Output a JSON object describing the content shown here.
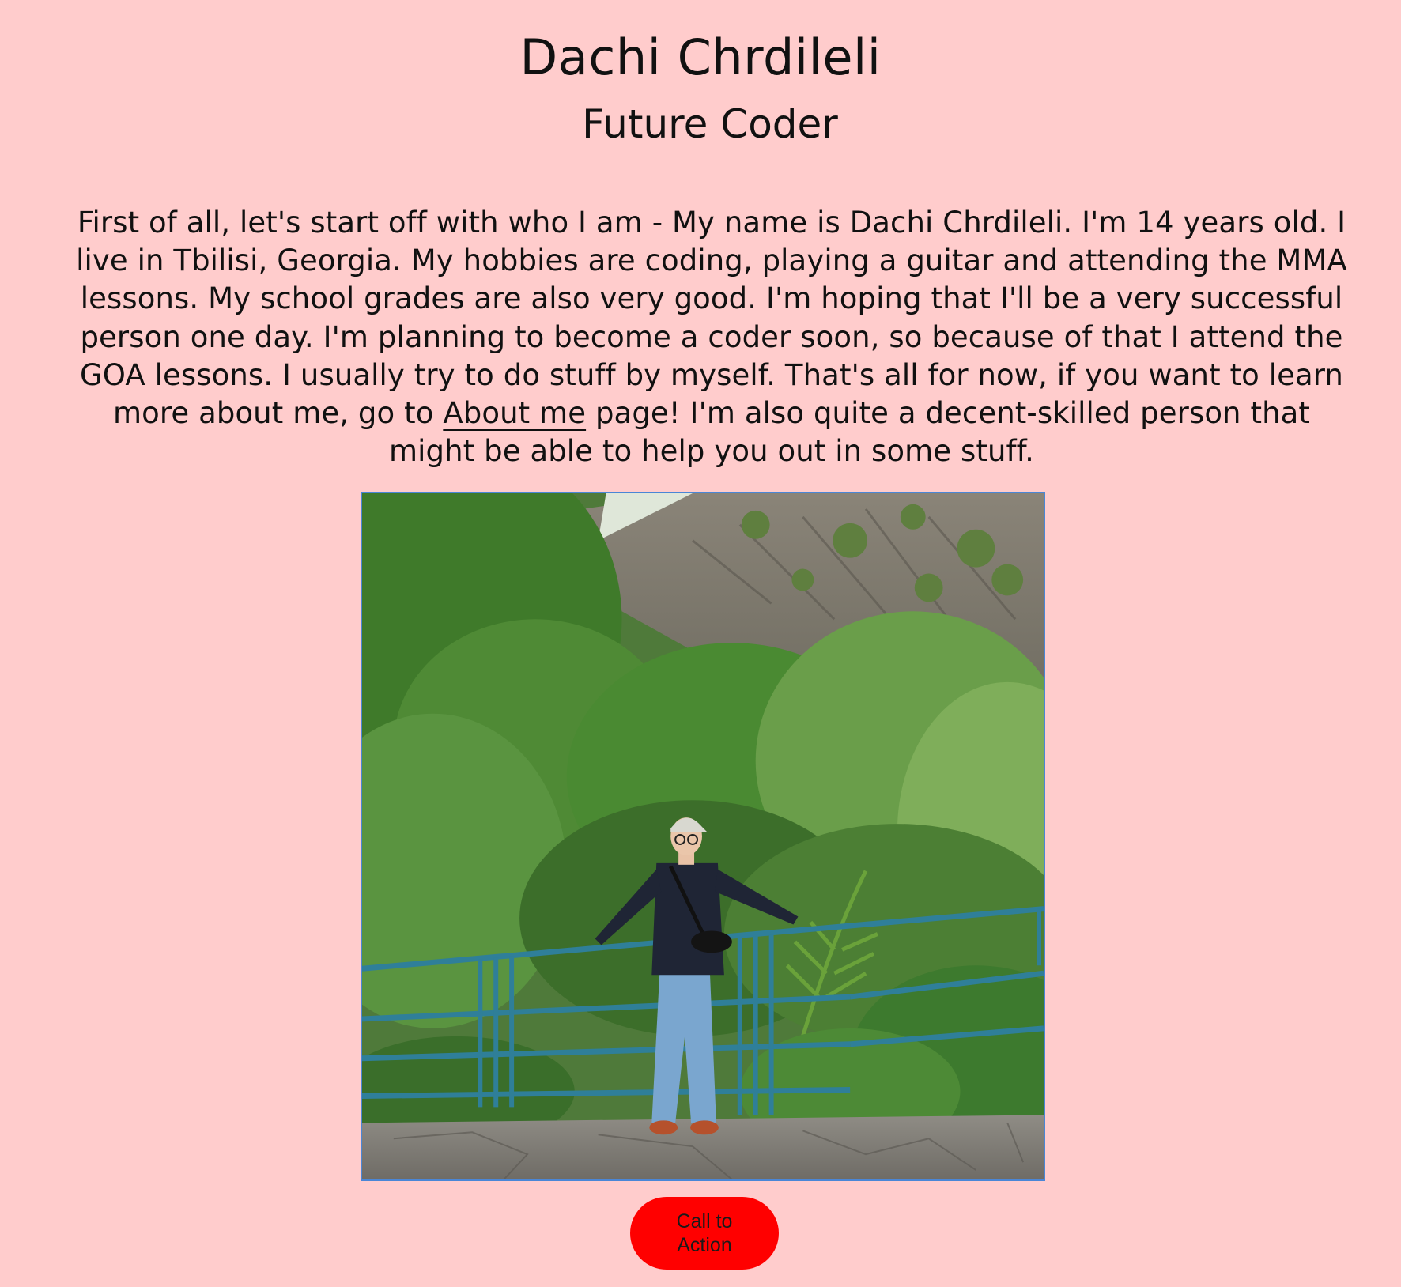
{
  "header": {
    "name": "Dachi Chrdileli",
    "tagline": "Future Coder"
  },
  "intro": {
    "text_before_link": "First of all, let's start off with who I am - My name is Dachi Chrdileli. I'm 14 years old. I live in Tbilisi, Georgia. My hobbies are coding, playing a guitar and attending the MMA lessons. My school grades are also very good. I'm hoping that I'll be a very successful person one day. I'm planning to become a coder soon, so because of that I attend the GOA lessons. I usually try to do stuff by myself. That's all for now, if you want to learn more about me, go to ",
    "link_label": "About me",
    "text_after_link": " page! I'm also quite a decent-skilled person that might be able to help you out in some stuff."
  },
  "photo": {
    "border_color": "#4a86d6"
  },
  "cta": {
    "label": "Call to Action",
    "color": "#ff0000"
  },
  "colors": {
    "background": "#ffcccc",
    "text": "#111111"
  }
}
